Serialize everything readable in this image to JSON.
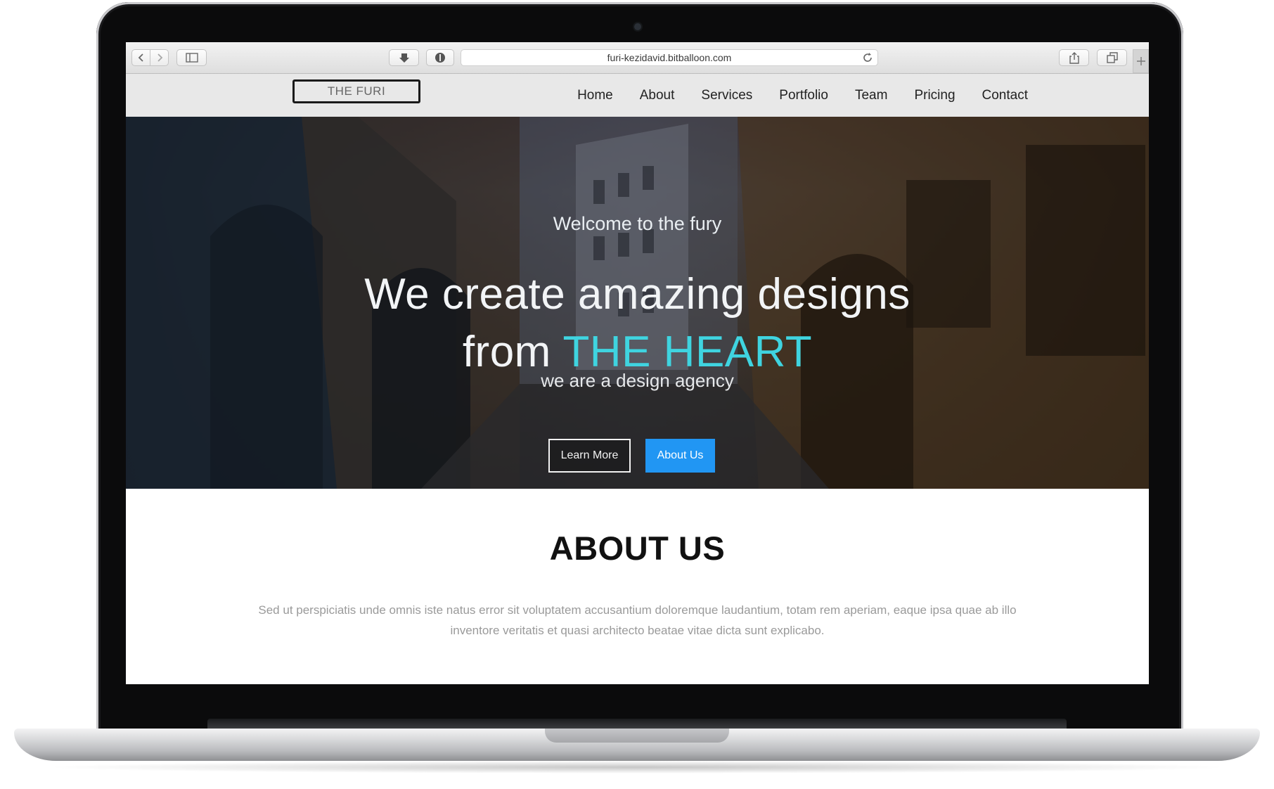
{
  "browser": {
    "url": "furi-kezidavid.bitballoon.com"
  },
  "site": {
    "brand": "THE FURI",
    "nav": [
      "Home",
      "About",
      "Services",
      "Portfolio",
      "Team",
      "Pricing",
      "Contact"
    ]
  },
  "hero": {
    "welcome": "Welcome to the fury",
    "headline_line1": "We create amazing designs",
    "headline_line2_prefix": "from ",
    "headline_accent": "THE HEART",
    "tagline": "we are a design agency",
    "learn_more_label": "Learn More",
    "about_us_label": "About Us"
  },
  "about": {
    "title": "ABOUT US",
    "text": "Sed ut perspiciatis unde omnis iste natus error sit voluptatem accusantium doloremque laudantium, totam rem aperiam, eaque ipsa quae ab illo inventore veritatis et quasi architecto beatae vitae dicta sunt explicabo."
  },
  "colors": {
    "accent": "#3fd4e0",
    "button_primary": "#2196f3",
    "nav_background": "#e8e8e8"
  },
  "icons": {
    "back": "chevron-left-icon",
    "forward": "chevron-right-icon",
    "sidebar": "sidebar-icon",
    "download": "download-icon",
    "privacy": "shield-icon",
    "reload": "reload-icon",
    "share": "share-icon",
    "tabs": "tabs-icon",
    "new_tab": "plus-icon"
  }
}
